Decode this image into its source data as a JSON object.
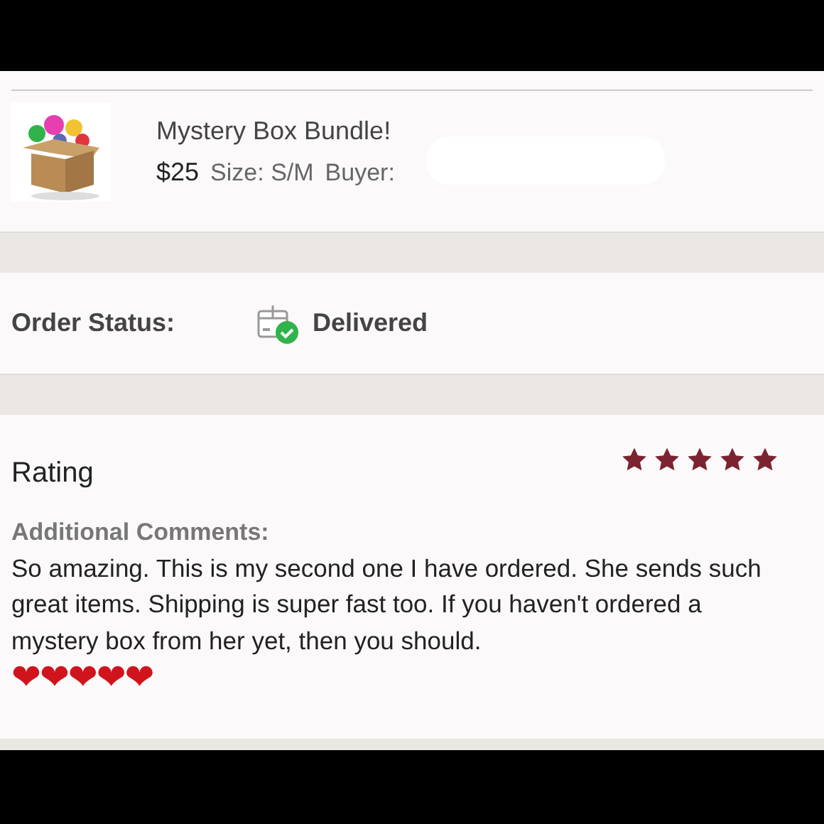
{
  "item": {
    "kind": "picture",
    "title": "Mystery Box Bundle!",
    "price": "$25",
    "size": "Size: S/M",
    "buyer_label": "Buyer:"
  },
  "order_status": {
    "label": "Order Status:",
    "value": "Delivered",
    "delivered": true
  },
  "rating": {
    "label": "Rating",
    "stars": 5,
    "comments_label": "Additional Comments:",
    "comment": "So amazing. This is my second one I have ordered. She sends such great items. Shipping is super fast too. If you haven't ordered a mystery box from her yet, then you should.",
    "comment_emoji": "❤❤❤❤❤"
  }
}
